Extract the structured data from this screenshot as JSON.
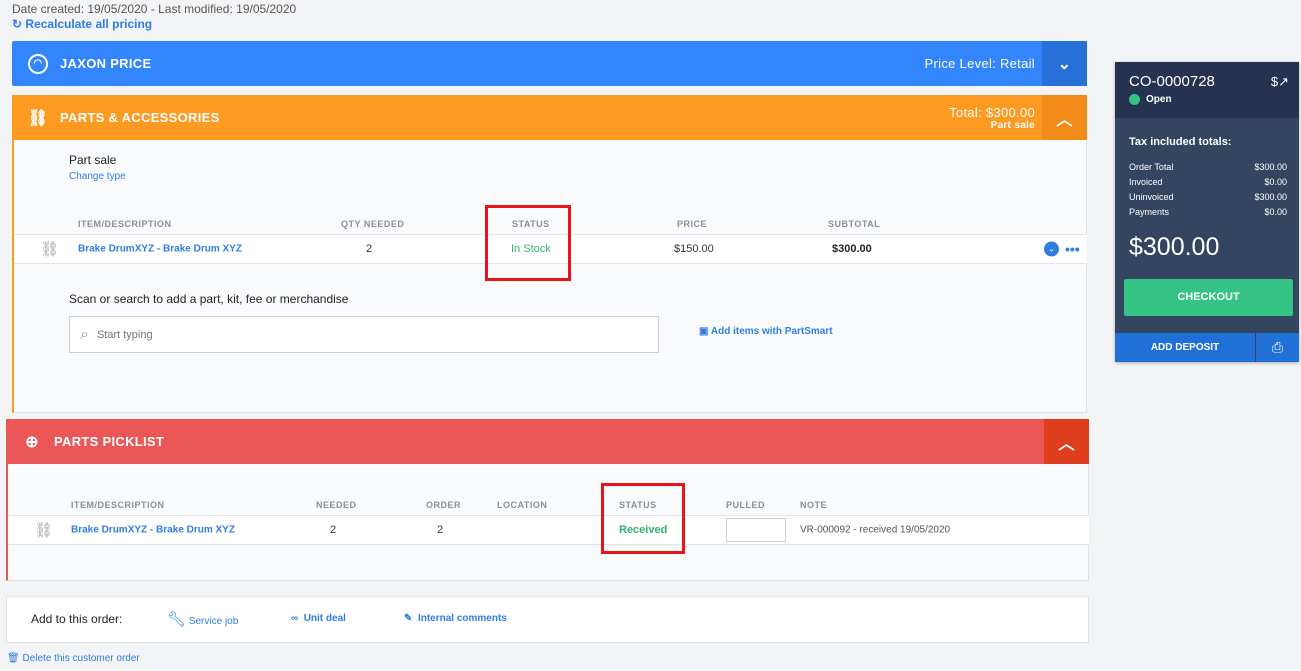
{
  "meta": {
    "dates": "Date created: 19/05/2020 - Last modified: 19/05/2020",
    "recalc": "Recalculate all pricing"
  },
  "customer": {
    "name": "JAXON PRICE",
    "price_level": "Price Level: Retail"
  },
  "parts": {
    "title": "PARTS & ACCESSORIES",
    "total": "Total: $300.00",
    "type": "Part sale",
    "sale_label": "Part sale",
    "change_type": "Change type",
    "columns": [
      "ITEM/DESCRIPTION",
      "QTY NEEDED",
      "STATUS",
      "PRICE",
      "SUBTOTAL"
    ],
    "rows": [
      {
        "item": "Brake DrumXYZ - Brake Drum XYZ",
        "qty": "2",
        "status": "In Stock",
        "price": "$150.00",
        "subtotal": "$300.00"
      }
    ],
    "scan_label": "Scan or search to add a part, kit, fee or merchandise",
    "search_placeholder": "Start typing",
    "partsmart": "Add items with PartSmart"
  },
  "picklist": {
    "title": "PARTS PICKLIST",
    "columns": [
      "ITEM/DESCRIPTION",
      "NEEDED",
      "ORDER",
      "LOCATION",
      "STATUS",
      "PULLED",
      "NOTE"
    ],
    "rows": [
      {
        "item": "Brake DrumXYZ - Brake Drum XYZ",
        "needed": "2",
        "order": "2",
        "location": "",
        "status": "Received",
        "pulled": "",
        "note": "VR-000092 - received 19/05/2020"
      }
    ]
  },
  "add": {
    "label": "Add to this order:",
    "service": "Service job",
    "unit": "Unit deal",
    "comments": "Internal comments"
  },
  "delete": "Delete this customer order",
  "summary": {
    "order_id": "CO-0000728",
    "status": "Open",
    "tax_title": "Tax included totals:",
    "lines": [
      {
        "label": "Order Total",
        "value": "$300.00"
      },
      {
        "label": "Invoiced",
        "value": "$0.00"
      },
      {
        "label": "Uninvoiced",
        "value": "$300.00"
      },
      {
        "label": "Payments",
        "value": "$0.00"
      }
    ],
    "balance": "$300.00",
    "checkout": "CHECKOUT",
    "deposit": "ADD DEPOSIT"
  },
  "colors": {
    "blue": "#3385fb",
    "orange": "#fd9a22",
    "red": "#eb5757",
    "green": "#36c486",
    "navy": "#344560"
  }
}
